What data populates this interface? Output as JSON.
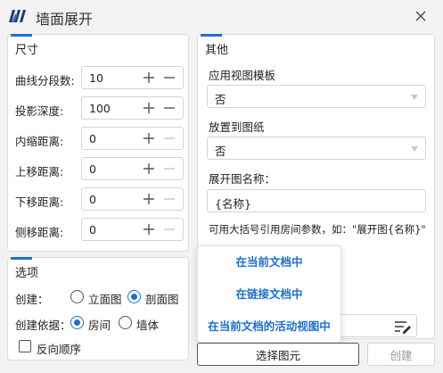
{
  "window": {
    "title": "墙面展开"
  },
  "dimensions_panel": {
    "title": "尺寸",
    "rows": [
      {
        "label": "曲线分段数:",
        "value": "10"
      },
      {
        "label": "投影深度:",
        "value": "100"
      },
      {
        "label": "内缩距离:",
        "value": "0"
      },
      {
        "label": "上移距离:",
        "value": "0"
      },
      {
        "label": "下移距离:",
        "value": "0"
      },
      {
        "label": "侧移距离:",
        "value": "0"
      }
    ]
  },
  "options_panel": {
    "title": "选项",
    "create_label": "创建：",
    "create_options": [
      "立面图",
      "剖面图"
    ],
    "create_selected": "剖面图",
    "basis_label": "创建依据：",
    "basis_options": [
      "房间",
      "墙体"
    ],
    "basis_selected": "房间",
    "reverse_label": "反向顺序",
    "reverse_checked": false
  },
  "other_panel": {
    "title": "其他",
    "apply_template_label": "应用视图模板",
    "apply_template_value": "否",
    "place_on_sheet_label": "放置到图纸",
    "place_on_sheet_value": "否",
    "view_name_label": "展开图名称：",
    "view_name_value": "{名称}",
    "hint": "可用大括号引用房间参数，如：\"展开图{名称}\""
  },
  "dropdown_menu": {
    "items": [
      "在当前文档中",
      "在链接文档中",
      "在当前文档的活动视图中"
    ]
  },
  "buttons": {
    "select_elements": "选择图元",
    "create": "创建"
  },
  "colors": {
    "accent": "#1f6fd1",
    "disabled_text": "#9a9a9a"
  }
}
